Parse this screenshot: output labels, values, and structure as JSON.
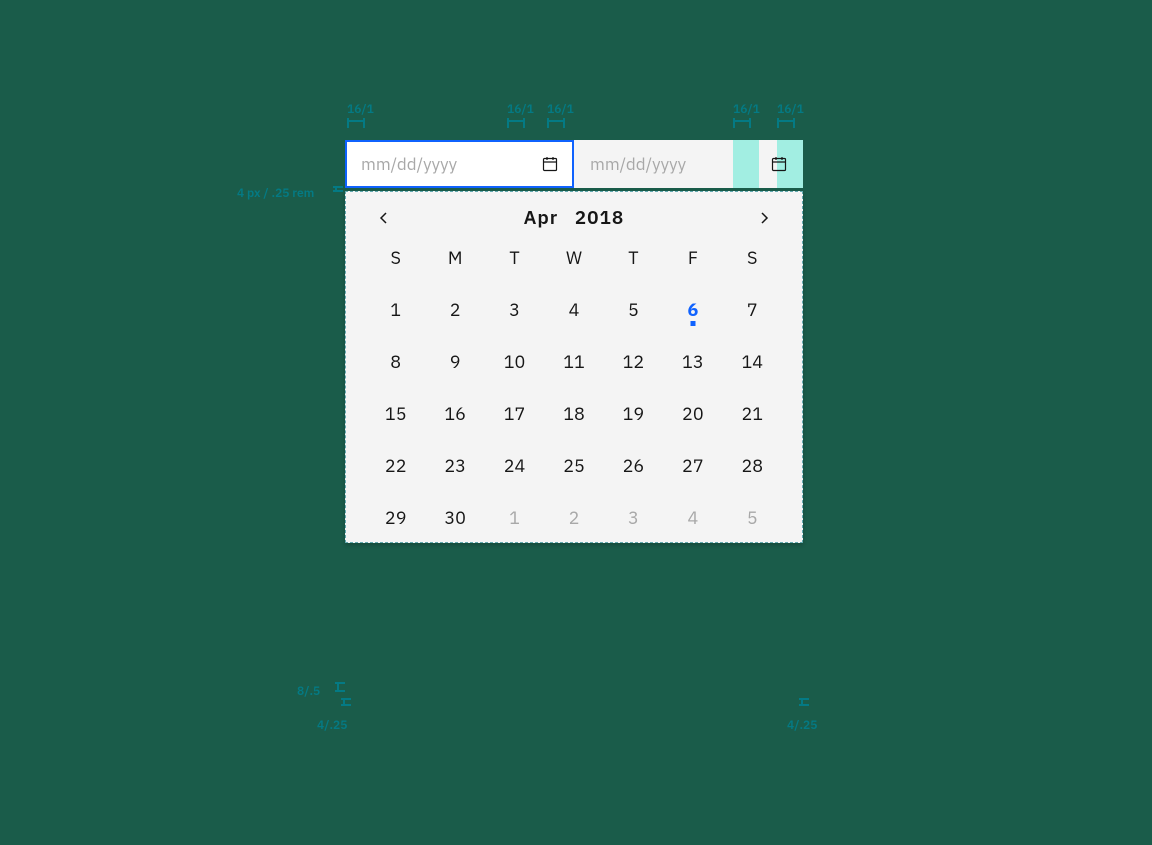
{
  "spec": {
    "top1": "16/1",
    "top2": "16/1",
    "top3": "16/1",
    "top4": "16/1",
    "top5": "16/1",
    "leftGap": "4 px / .25 rem",
    "bottomLeft": "8/.5",
    "bottomCorner1": "4/.25",
    "bottomCorner2": "4/.25"
  },
  "inputs": {
    "start": {
      "placeholder": "mm/dd/yyyy"
    },
    "end": {
      "placeholder": "mm/dd/yyyy"
    }
  },
  "calendar": {
    "month": "Apr",
    "year": "2018",
    "dow": [
      "S",
      "M",
      "T",
      "W",
      "T",
      "F",
      "S"
    ],
    "weeks": [
      [
        {
          "d": "1"
        },
        {
          "d": "2"
        },
        {
          "d": "3"
        },
        {
          "d": "4"
        },
        {
          "d": "5"
        },
        {
          "d": "6",
          "today": true
        },
        {
          "d": "7"
        }
      ],
      [
        {
          "d": "8"
        },
        {
          "d": "9"
        },
        {
          "d": "10"
        },
        {
          "d": "11"
        },
        {
          "d": "12"
        },
        {
          "d": "13"
        },
        {
          "d": "14"
        }
      ],
      [
        {
          "d": "15"
        },
        {
          "d": "16"
        },
        {
          "d": "17"
        },
        {
          "d": "18"
        },
        {
          "d": "19"
        },
        {
          "d": "20"
        },
        {
          "d": "21"
        }
      ],
      [
        {
          "d": "22"
        },
        {
          "d": "23"
        },
        {
          "d": "24"
        },
        {
          "d": "25"
        },
        {
          "d": "26"
        },
        {
          "d": "27"
        },
        {
          "d": "28"
        }
      ],
      [
        {
          "d": "29"
        },
        {
          "d": "30"
        },
        {
          "d": "1",
          "out": true
        },
        {
          "d": "2",
          "out": true
        },
        {
          "d": "3",
          "out": true
        },
        {
          "d": "4",
          "out": true
        },
        {
          "d": "5",
          "out": true
        }
      ]
    ]
  }
}
